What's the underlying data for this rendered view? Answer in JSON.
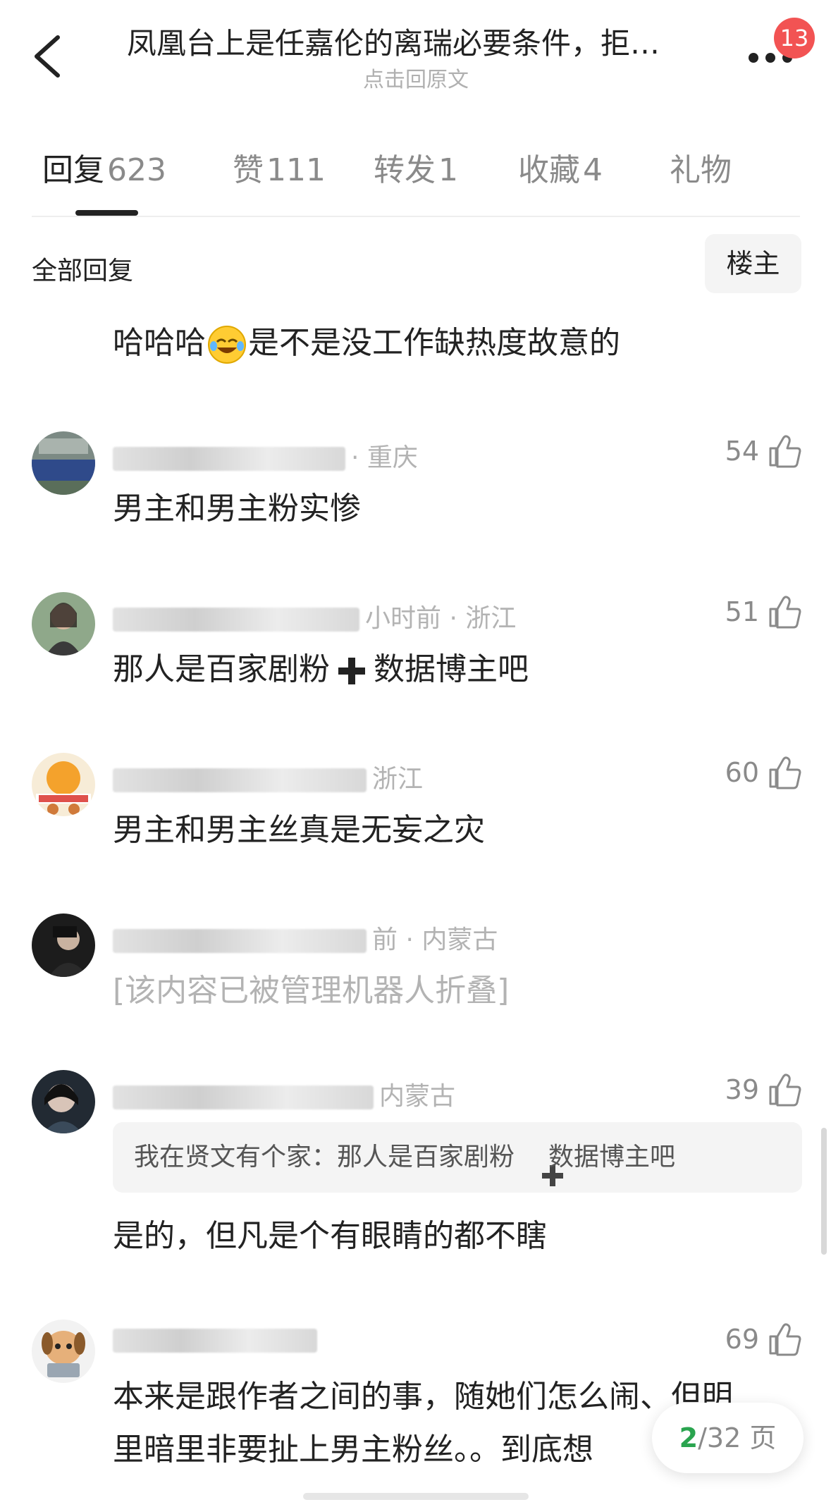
{
  "header": {
    "title": "凤凰台上是任嘉伦的离瑞必要条件，拒…",
    "subtitle": "点击回原文",
    "badge": "13"
  },
  "tabs": [
    {
      "label": "回复",
      "count": "623",
      "active": true
    },
    {
      "label": "赞",
      "count": "111"
    },
    {
      "label": "转发",
      "count": "1"
    },
    {
      "label": "收藏",
      "count": "4"
    },
    {
      "label": "礼物",
      "count": ""
    }
  ],
  "section": {
    "title": "全部回复",
    "filter": "楼主"
  },
  "top_text": {
    "before": "哈哈哈",
    "after": "是不是没工作缺热度故意的"
  },
  "comments": [
    {
      "meta": "· 重庆",
      "likes": "54",
      "text": "男主和男主粉实惨"
    },
    {
      "meta": "小时前 · 浙江",
      "likes": "51",
      "text_a": "那人是百家剧粉",
      "text_b": "数据博主吧"
    },
    {
      "meta": "浙江",
      "likes": "60",
      "text": "男主和男主丝真是无妄之灾"
    },
    {
      "meta": "前 · 内蒙古",
      "text": "[该内容已被管理机器人折叠]"
    },
    {
      "meta": "内蒙古",
      "likes": "39",
      "quote_a": "我在贤文有个家：那人是百家剧粉",
      "quote_b": "数据博主吧",
      "text": "是的，但凡是个有眼睛的都不瞎"
    },
    {
      "meta": "",
      "likes": "69",
      "text_line1": "本来是跟作者之间的事，随她们怎么闹、但明",
      "text_line2": "里暗里非要扯上男主粉丝。。到底想"
    }
  ],
  "pager": {
    "current": "2",
    "total": "/32 页"
  },
  "colors": {
    "accent_green": "#2aa44f",
    "badge_red": "#f25353"
  }
}
